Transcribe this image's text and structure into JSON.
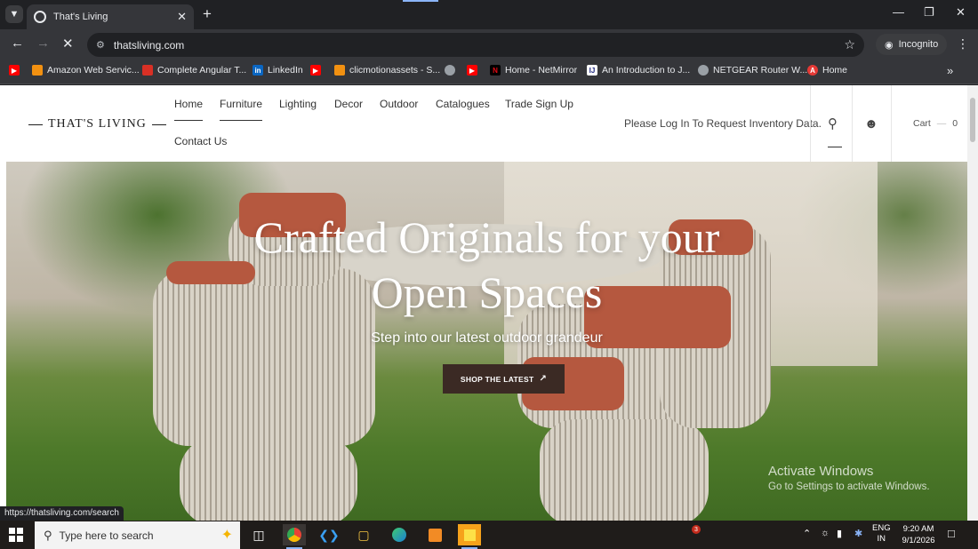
{
  "browser": {
    "tab": {
      "title": "That's Living"
    },
    "url": "thatsliving.com",
    "profile_label": "Incognito",
    "bookmarks": [
      {
        "label": "Amazon Web Servic...",
        "icon": "aws-icon",
        "color": "#f29111"
      },
      {
        "label": "Complete Angular T...",
        "icon": "bars-icon",
        "color": "#d93025"
      },
      {
        "label": "LinkedIn",
        "icon": "linkedin-icon",
        "color": "#0a66c2"
      },
      {
        "label": "clicmotionassets - S...",
        "icon": "aws-icon",
        "color": "#f29111"
      },
      {
        "label": "",
        "icon": "globe-icon",
        "color": "#9aa0a6"
      },
      {
        "label": "",
        "icon": "youtube-icon",
        "color": "#ff0000"
      },
      {
        "label": "Home - NetMirror",
        "icon": "netflix-icon",
        "color": "#e50914"
      },
      {
        "label": "An Introduction to J...",
        "icon": "ij-icon",
        "color": "#ffffff"
      },
      {
        "label": "NETGEAR Router W...",
        "icon": "globe-icon",
        "color": "#9aa0a6"
      },
      {
        "label": "Home",
        "icon": "triangle-icon",
        "color": "#e53935"
      }
    ],
    "status_url": "https://thatsliving.com/search"
  },
  "site": {
    "logo": "THAT'S LIVING",
    "nav": {
      "home": "Home",
      "furniture": "Furniture",
      "lighting": "Lighting",
      "decor": "Decor",
      "outdoor": "Outdoor",
      "catalogues": "Catalogues",
      "trade": "Trade Sign Up",
      "contact": "Contact Us"
    },
    "inventory_note": "Please Log In To Request Inventory Data.",
    "cart_label": "Cart",
    "cart_count": "0",
    "hero": {
      "title_line1": "Crafted Originals for your",
      "title_line2": "Open Spaces",
      "subtitle": "Step into our latest outdoor grandeur",
      "cta": "SHOP THE LATEST"
    }
  },
  "watermark": {
    "line1": "Activate Windows",
    "line2": "Go to Settings to activate Windows."
  },
  "taskbar": {
    "search_placeholder": "Type here to search",
    "badge_count": "3",
    "lang_line1": "ENG",
    "lang_line2": "IN",
    "time": "9:20 AM",
    "date": "9/1/2026"
  }
}
